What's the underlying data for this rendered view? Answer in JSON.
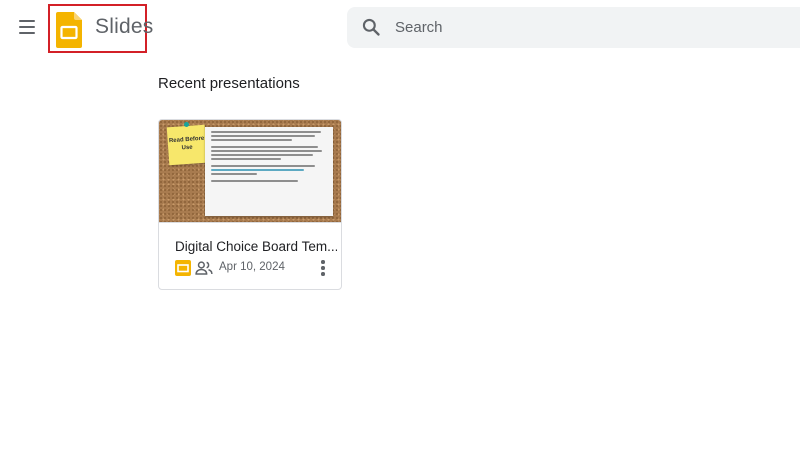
{
  "header": {
    "app_name": "Slides",
    "search": {
      "placeholder": "Search",
      "value": ""
    }
  },
  "main": {
    "section_title": "Recent presentations",
    "presentations": [
      {
        "title": "Digital Choice Board Tem...",
        "date": "Apr 10, 2024",
        "thumbnail_note": "Read Before Use",
        "icons": [
          "slides-icon",
          "shared-icon",
          "more-vert-icon"
        ]
      }
    ]
  },
  "colors": {
    "slides_brand": "#f4b400",
    "highlight_border": "#d32027",
    "search_bg": "#f1f3f4",
    "text_secondary": "#5f6368"
  }
}
